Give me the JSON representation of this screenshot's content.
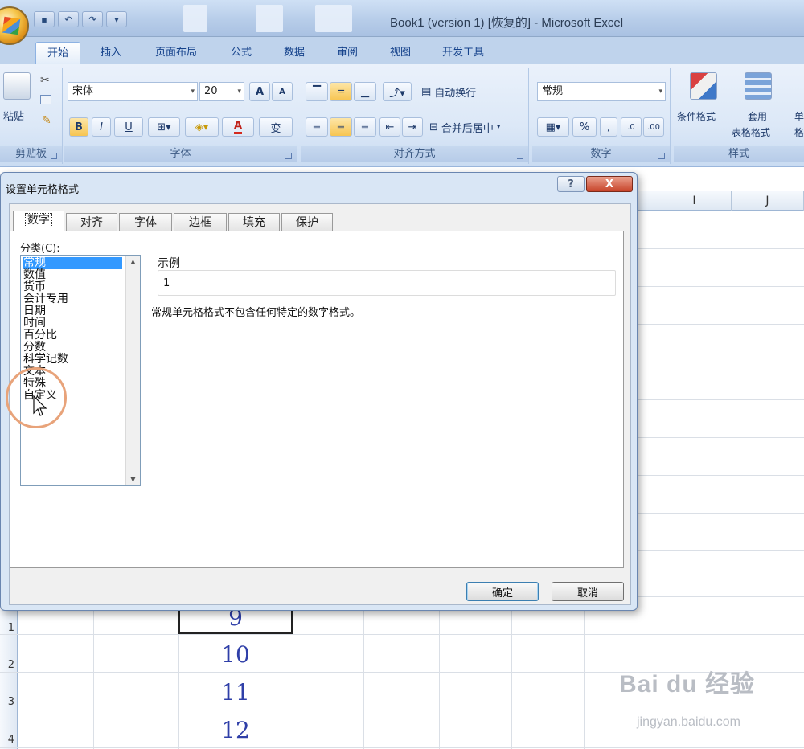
{
  "window": {
    "title": "Book1 (version 1) [恢复的] - Microsoft Excel"
  },
  "ribbon_tabs": [
    "开始",
    "插入",
    "页面布局",
    "公式",
    "数据",
    "审阅",
    "视图",
    "开发工具"
  ],
  "ribbon": {
    "clipboard": {
      "paste": "粘贴",
      "label": "剪贴板"
    },
    "font": {
      "name": "宋体",
      "size": "20",
      "label": "字体",
      "grow": "A",
      "shrink": "A",
      "bold": "B",
      "italic": "I",
      "underline": "U",
      "font_color": "A",
      "phonetic": "变"
    },
    "alignment": {
      "wrap_text": "自动换行",
      "merge_center": "合并后居中",
      "label": "对齐方式"
    },
    "number": {
      "format": "常规",
      "percent": "%",
      "comma": ",",
      "label": "数字"
    },
    "styles": {
      "conditional": "条件格式",
      "table_format_1": "套用",
      "table_format_2": "表格格式",
      "cell_styles": "单",
      "cell_styles_2": "格",
      "label": "样式"
    }
  },
  "sheet": {
    "columns": [
      "I",
      "J"
    ],
    "rows": [
      {
        "num": "1",
        "value": "9"
      },
      {
        "num": "2",
        "value": "10"
      },
      {
        "num": "3",
        "value": "11"
      },
      {
        "num": "4",
        "value": "12"
      }
    ]
  },
  "dialog": {
    "title": "设置单元格格式",
    "help": "?",
    "close": "X",
    "tabs": [
      "数字",
      "对齐",
      "字体",
      "边框",
      "填充",
      "保护"
    ],
    "category_label": "分类(C):",
    "categories": [
      "常规",
      "数值",
      "货币",
      "会计专用",
      "日期",
      "时间",
      "百分比",
      "分数",
      "科学记数",
      "文本",
      "特殊",
      "自定义"
    ],
    "selected_category": "常规",
    "sample_label": "示例",
    "sample_value": "1",
    "description": "常规单元格格式不包含任何特定的数字格式。",
    "ok": "确定",
    "cancel": "取消"
  },
  "watermark": {
    "brand": "Bai du 经验",
    "url": "jingyan.baidu.com"
  }
}
